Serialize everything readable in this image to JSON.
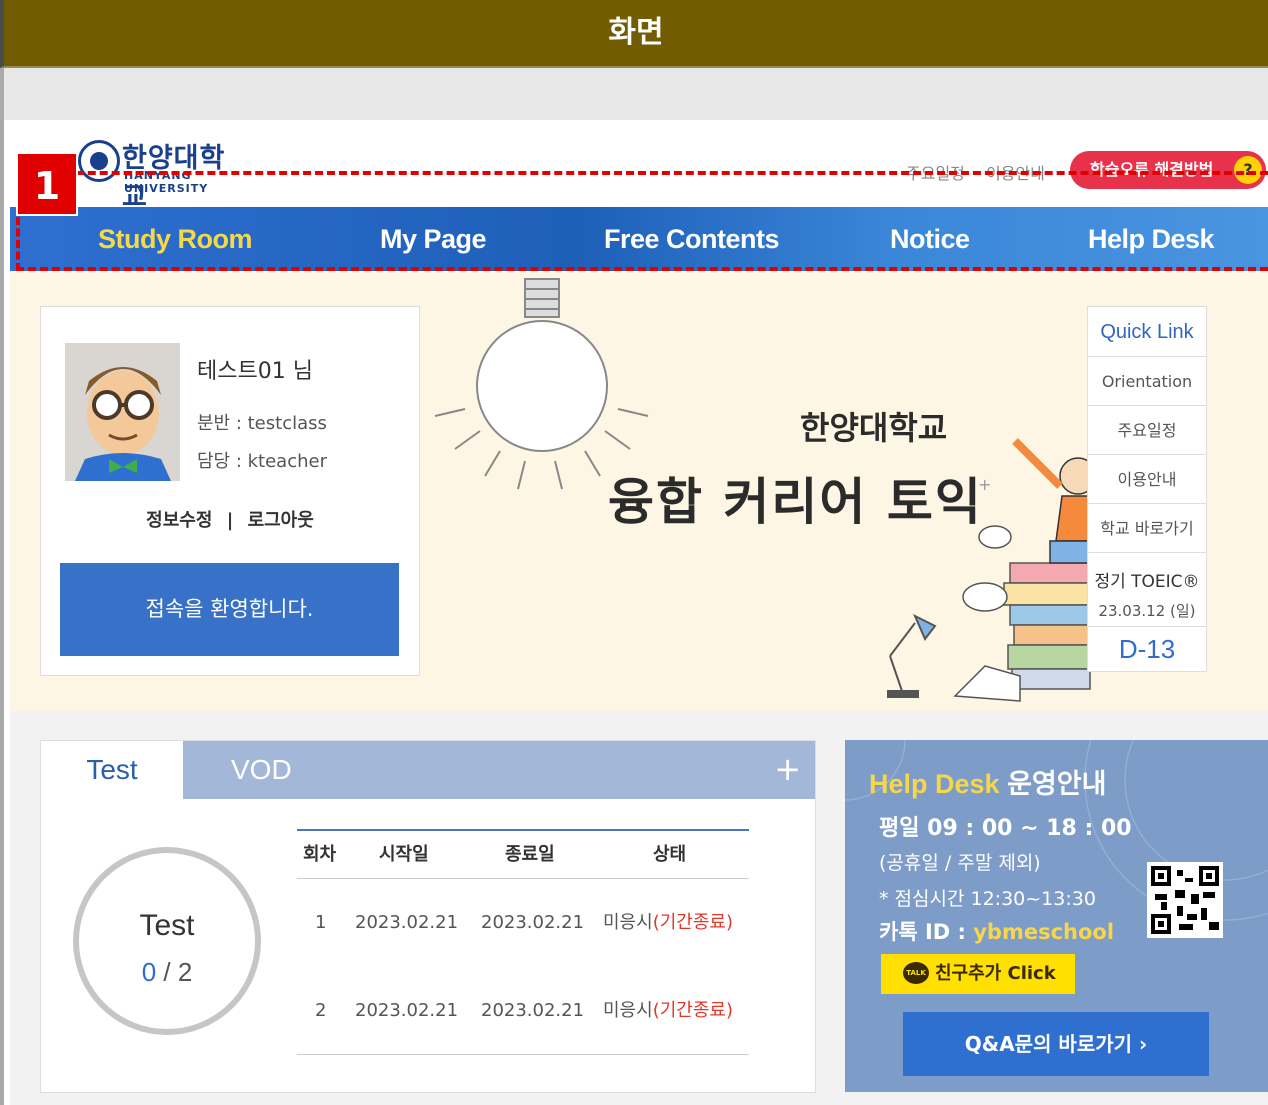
{
  "title_bar": "화면",
  "header": {
    "logo_kr": "한양대학교",
    "logo_en": "HANYANG UNIVERSITY",
    "util_links": [
      "주요일정",
      "이용안내"
    ],
    "error_button": "학습오류 해결방법",
    "error_icon_label": "?"
  },
  "nav": {
    "items": [
      "Study Room",
      "My Page",
      "Free Contents",
      "Notice",
      "Help Desk"
    ],
    "active_index": 0
  },
  "highlight_badge": "1",
  "profile": {
    "name": "테스트01 님",
    "class_row": "분반 : testclass",
    "teacher_row": "담당 : kteacher",
    "edit_link": "정보수정",
    "divider": "|",
    "logout_link": "로그아웃",
    "welcome": "접속을 환영합니다."
  },
  "hero": {
    "subtitle": "한양대학교",
    "title": "융합 커리어 토익"
  },
  "quick_link": {
    "title": "Quick Link",
    "items": [
      "Orientation",
      "주요일정",
      "이용안내",
      "학교 바로가기"
    ],
    "toeic_title": "정기 TOEIC®",
    "toeic_date": "23.03.12 (일)",
    "dday": "D-13"
  },
  "test_panel": {
    "tabs": [
      "Test",
      "VOD"
    ],
    "plus": "+",
    "ring_label": "Test",
    "done": "0",
    "total": " / 2",
    "headers": [
      "회차",
      "시작일",
      "종료일",
      "상태"
    ],
    "rows": [
      {
        "no": "1",
        "start": "2023.02.21",
        "end": "2023.02.21",
        "status": "미응시",
        "note": "(기간종료)"
      },
      {
        "no": "2",
        "start": "2023.02.21",
        "end": "2023.02.21",
        "status": "미응시",
        "note": "(기간종료)"
      }
    ]
  },
  "help_desk": {
    "title_hl": "Help Desk",
    "title_rest": " 운영안내",
    "hours": "평일 09 : 00 ~ 18 : 00",
    "excl": "(공휴일 / 주말 제외)",
    "lunch": "* 점심시간 12:30~13:30",
    "kakao_label": "카톡 ID : ",
    "kakao_id": "ybmeschool",
    "kakao_btn": "친구추가 Click",
    "kakao_icon_text": "TALK",
    "qna_btn": "Q&A문의 바로가기  ›"
  },
  "colors": {
    "title_bar": "#725c00",
    "nav_blue": "#1e5fb8",
    "active_nav": "#f3d94a",
    "accent_red": "#e00000",
    "error_btn": "#e8314a",
    "welcome_btn": "#3771c8",
    "kakao": "#ffe000"
  }
}
